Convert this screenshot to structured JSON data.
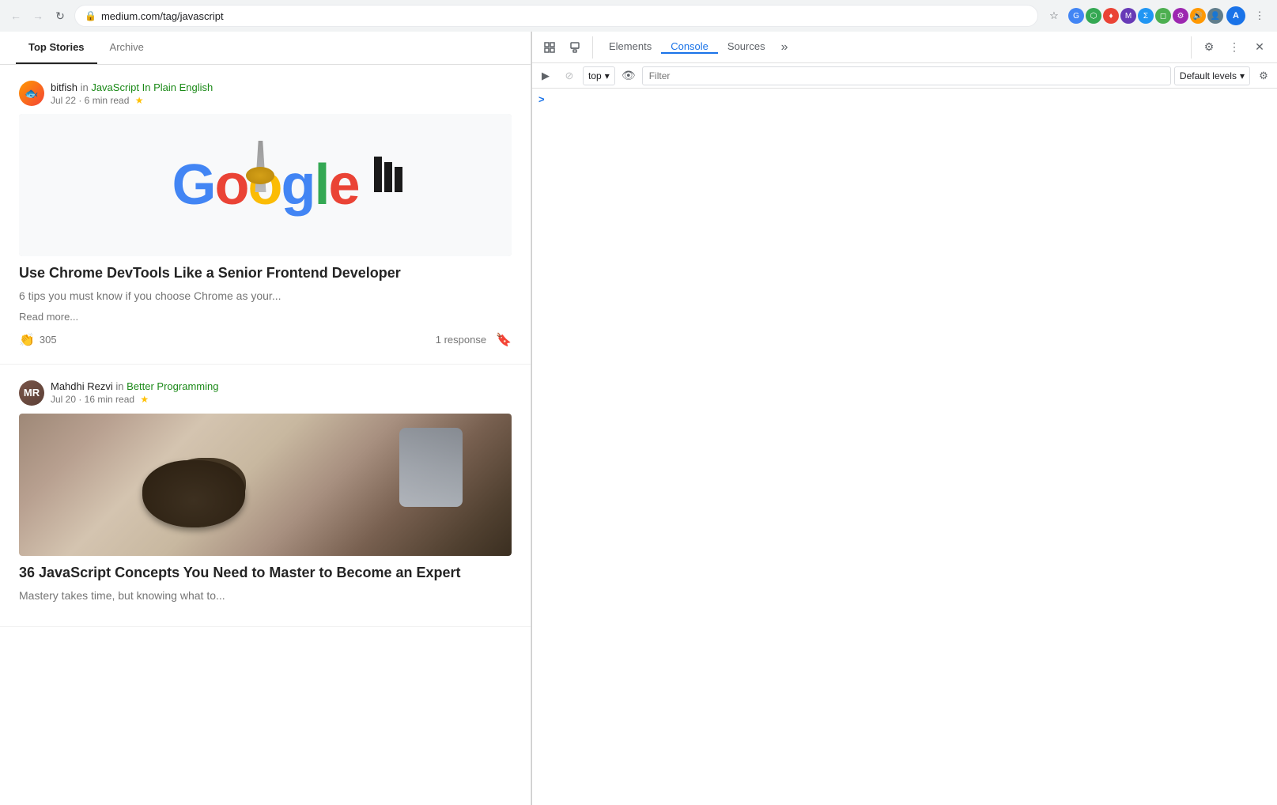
{
  "browser": {
    "url": "medium.com/tag/javascript",
    "url_display": "medium.com/tag/javascript",
    "lock_icon": "🔒",
    "nav": {
      "back_disabled": true,
      "forward_disabled": true,
      "reload": "↻",
      "star_icon": "☆"
    }
  },
  "page": {
    "nav_items": [
      {
        "label": "Top Stories",
        "active": true
      },
      {
        "label": "Archive",
        "active": false
      }
    ],
    "articles": [
      {
        "id": "article-1",
        "author": {
          "name": "bitfish",
          "publication": "JavaScript In Plain English",
          "avatar_type": "fish"
        },
        "meta": "Jul 22 · 6 min read",
        "starred": true,
        "has_image": true,
        "image_type": "google-logo",
        "title": "Use Chrome DevTools Like a Senior Frontend Developer",
        "subtitle": "6 tips you must know if you choose Chrome as your...",
        "read_more": "Read more...",
        "claps": "305",
        "responses": "1 response"
      },
      {
        "id": "article-2",
        "author": {
          "name": "Mahdhi Rezvi",
          "in": "in",
          "publication": "Better Programming",
          "avatar_type": "person"
        },
        "meta": "Jul 20 · 16 min read",
        "starred": true,
        "has_image": true,
        "image_type": "bowl",
        "title": "36 JavaScript Concepts You Need to Master to Become an Expert",
        "subtitle": "Mastery takes time, but knowing what to...",
        "read_more": "",
        "claps": "",
        "responses": ""
      }
    ]
  },
  "devtools": {
    "tabs": [
      {
        "label": "Elements",
        "active": false
      },
      {
        "label": "Console",
        "active": true
      },
      {
        "label": "Sources",
        "active": false
      }
    ],
    "tab_more": "»",
    "console": {
      "context": "top",
      "filter_placeholder": "Filter",
      "levels": "Default levels",
      "prompt_arrow": ">"
    },
    "icons": {
      "cursor_icon": "⬚",
      "device_icon": "□",
      "block_icon": "⊘",
      "play_icon": "▶",
      "eye_icon": "👁",
      "gear_icon": "⚙",
      "dots_icon": "⋮",
      "close_icon": "✕",
      "down_arrow": "▾"
    }
  }
}
